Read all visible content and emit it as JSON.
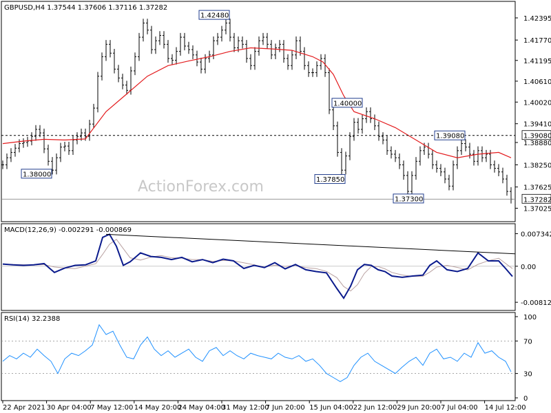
{
  "main_header": "GBPUSD,H4  1.37544 1.37606 1.37116 1.37282",
  "macd_header": "MACD(12,26,9) -0.002291 -0.000869",
  "rsi_header": "RSI(14) 32.2388",
  "watermark": "ActionForex.com",
  "colors": {
    "price": "#000000",
    "sma": "#e31a1c",
    "macd": "#0a1a8c",
    "signal": "#b8a0a0",
    "rsi": "#1e90ff",
    "label_border": "#1f3b8c"
  },
  "chart_data": [
    {
      "type": "line",
      "panel": "price",
      "ylim": [
        1.36725,
        1.4255
      ],
      "y_ticks": [
        "1.42395",
        "1.41770",
        "1.41195",
        "1.40610",
        "1.40020",
        "1.39410",
        "1.38880",
        "1.38250",
        "1.37625",
        "1.37025"
      ],
      "y_tick_values": [
        1.42395,
        1.4177,
        1.41195,
        1.4061,
        1.4002,
        1.3941,
        1.3888,
        1.3825,
        1.37625,
        1.37025
      ],
      "series": [
        {
          "style": "bar",
          "x": [
            0,
            6,
            12,
            18,
            24,
            30,
            36,
            42,
            48,
            54,
            60,
            66,
            72,
            78,
            84,
            90,
            96,
            102,
            108,
            114,
            120,
            126,
            132,
            138,
            144,
            150,
            156,
            162,
            168,
            174,
            180,
            186,
            192,
            198,
            204,
            210,
            216,
            222,
            228,
            234,
            240,
            246,
            252,
            258,
            264,
            270,
            276,
            282,
            288,
            294,
            300,
            306,
            312,
            318,
            324,
            330,
            336,
            342,
            348,
            354,
            360,
            366,
            372,
            378,
            384,
            390,
            396,
            402,
            408,
            414,
            420,
            426,
            432,
            438,
            444,
            450,
            456,
            462,
            468,
            474,
            480,
            486,
            492,
            498,
            504,
            510,
            516,
            522,
            528,
            534,
            540,
            546,
            552,
            558,
            564,
            570,
            576,
            582,
            588,
            594,
            600,
            606,
            612,
            618,
            624,
            630,
            636,
            642,
            648,
            654,
            660,
            666,
            672,
            678,
            684,
            690,
            696,
            702,
            708,
            714,
            720,
            726,
            732,
            738
          ],
          "values": [
            1.3825,
            1.3845,
            1.386,
            1.3872,
            1.3885,
            1.3888,
            1.3892,
            1.3905,
            1.3925,
            1.3915,
            1.387,
            1.3835,
            1.381,
            1.3845,
            1.3875,
            1.3878,
            1.3865,
            1.3895,
            1.3905,
            1.3915,
            1.3905,
            1.394,
            1.3985,
            1.4075,
            1.413,
            1.4165,
            1.414,
            1.4095,
            1.407,
            1.405,
            1.4035,
            1.409,
            1.413,
            1.4185,
            1.4225,
            1.4205,
            1.415,
            1.4175,
            1.419,
            1.4165,
            1.4125,
            1.412,
            1.4145,
            1.4185,
            1.416,
            1.415,
            1.4135,
            1.4115,
            1.4095,
            1.4125,
            1.4135,
            1.4175,
            1.4185,
            1.4205,
            1.4225,
            1.4185,
            1.4155,
            1.4175,
            1.4165,
            1.4125,
            1.4105,
            1.4145,
            1.4175,
            1.4185,
            1.4165,
            1.4135,
            1.4155,
            1.4165,
            1.4125,
            1.4105,
            1.4135,
            1.4175,
            1.4145,
            1.4105,
            1.4085,
            1.4085,
            1.4105,
            1.4125,
            1.4085,
            1.398,
            1.3935,
            1.386,
            1.381,
            1.385,
            1.3905,
            1.3945,
            1.3925,
            1.3955,
            1.3975,
            1.3955,
            1.3935,
            1.3905,
            1.3895,
            1.3865,
            1.3855,
            1.3845,
            1.3825,
            1.3795,
            1.375,
            1.3795,
            1.3835,
            1.3865,
            1.3875,
            1.3855,
            1.3825,
            1.3815,
            1.3805,
            1.3785,
            1.3765,
            1.3825,
            1.3865,
            1.3885,
            1.3875,
            1.3855,
            1.3835,
            1.3865,
            1.3845,
            1.3855,
            1.3825,
            1.3815,
            1.3805,
            1.3785,
            1.375,
            1.3728
          ]
        },
        {
          "name": "SMA",
          "x": [
            0,
            30,
            60,
            90,
            120,
            150,
            180,
            210,
            240,
            270,
            300,
            330,
            360,
            390,
            420,
            450,
            465,
            480,
            495,
            510,
            540,
            570,
            600,
            630,
            660,
            690,
            720,
            738
          ],
          "values": [
            1.3885,
            1.3892,
            1.3897,
            1.3895,
            1.3898,
            1.3975,
            1.4025,
            1.4075,
            1.4105,
            1.4118,
            1.413,
            1.4145,
            1.4155,
            1.4152,
            1.4148,
            1.413,
            1.4115,
            1.408,
            1.402,
            1.3975,
            1.3955,
            1.393,
            1.3895,
            1.386,
            1.3845,
            1.3855,
            1.386,
            1.3845
          ]
        }
      ],
      "annotations": [
        "1.42480",
        "1.38000",
        "1.40000",
        "1.37850",
        "1.39080",
        "1.37300"
      ],
      "annotation_values": [
        1.4248,
        1.38,
        1.4,
        1.3785,
        1.3908,
        1.373
      ],
      "annotation_x": [
        331,
        73,
        524,
        499,
        673,
        613
      ],
      "horizontal_level": "1.39080",
      "last_price": "1.37282"
    },
    {
      "type": "line",
      "panel": "macd",
      "ylim": [
        -0.0095,
        0.0085
      ],
      "y_ticks": [
        "0.007342",
        "0.00",
        "-0.008126"
      ],
      "y_tick_values": [
        0.007342,
        0.0,
        -0.008126
      ],
      "series": [
        {
          "name": "MACD",
          "x": [
            0,
            15,
            30,
            45,
            60,
            75,
            90,
            105,
            120,
            135,
            145,
            155,
            165,
            175,
            185,
            200,
            215,
            230,
            245,
            260,
            275,
            290,
            305,
            320,
            335,
            350,
            365,
            380,
            395,
            410,
            425,
            440,
            455,
            470,
            485,
            495,
            505,
            515,
            525,
            535,
            545,
            555,
            565,
            580,
            595,
            610,
            620,
            630,
            645,
            660,
            675,
            690,
            705,
            720,
            730,
            740
          ],
          "values": [
            0.0005,
            0.0003,
            0.0002,
            0.0003,
            0.0006,
            -0.0014,
            -0.0004,
            0.0002,
            0.0003,
            0.0012,
            0.0065,
            0.0072,
            0.0045,
            0.0002,
            0.001,
            0.003,
            0.0022,
            0.002,
            0.0015,
            0.002,
            0.001,
            0.0015,
            0.0008,
            0.0016,
            0.0012,
            -0.0005,
            0.0002,
            -0.0003,
            0.0008,
            -0.0006,
            0.0004,
            -0.0008,
            -0.0012,
            -0.0015,
            -0.005,
            -0.0072,
            -0.0045,
            -0.0008,
            0.0004,
            0.0002,
            -0.0008,
            -0.0012,
            -0.0022,
            -0.0025,
            -0.0022,
            -0.002,
            0.0002,
            0.0012,
            -0.0008,
            -0.0012,
            -0.0005,
            0.003,
            0.0012,
            0.0012,
            -0.0005,
            -0.0023
          ]
        }
      ],
      "trendline": "from the MACD peak near 7 May 12:00 down to the right edge"
    },
    {
      "type": "line",
      "panel": "rsi",
      "ylim": [
        0,
        100
      ],
      "y_ticks": [
        "100",
        "70",
        "30",
        "0"
      ],
      "y_tick_values": [
        100,
        70,
        30,
        0
      ],
      "series": [
        {
          "name": "RSI",
          "x": [
            0,
            10,
            20,
            30,
            40,
            50,
            60,
            70,
            80,
            90,
            100,
            110,
            120,
            130,
            140,
            150,
            160,
            170,
            180,
            190,
            200,
            210,
            220,
            230,
            240,
            250,
            260,
            270,
            280,
            290,
            300,
            310,
            320,
            330,
            340,
            350,
            360,
            370,
            380,
            390,
            400,
            410,
            420,
            430,
            440,
            450,
            460,
            470,
            480,
            490,
            500,
            510,
            520,
            530,
            540,
            550,
            560,
            570,
            580,
            590,
            600,
            610,
            620,
            630,
            640,
            650,
            660,
            670,
            680,
            690,
            700,
            710,
            720,
            730,
            738
          ],
          "values": [
            45,
            52,
            48,
            55,
            50,
            60,
            52,
            45,
            30,
            48,
            55,
            52,
            58,
            65,
            90,
            78,
            82,
            65,
            50,
            48,
            65,
            75,
            60,
            52,
            58,
            50,
            55,
            60,
            50,
            45,
            58,
            62,
            52,
            58,
            52,
            48,
            55,
            52,
            50,
            48,
            55,
            50,
            48,
            52,
            45,
            48,
            40,
            30,
            25,
            20,
            25,
            40,
            50,
            55,
            45,
            40,
            35,
            30,
            38,
            45,
            50,
            40,
            55,
            60,
            48,
            50,
            45,
            55,
            50,
            68,
            55,
            58,
            50,
            45,
            32
          ]
        }
      ]
    }
  ],
  "x_axis_labels": [
    "22 Apr 2021",
    "30 Apr 04:00",
    "7 May 12:00",
    "14 May 20:00",
    "24 May 04:00",
    "31 May 12:00",
    "7 Jun 20:00",
    "15 Jun 04:00",
    "22 Jun 12:00",
    "29 Jun 20:00",
    "7 Jul 04:00",
    "14 Jul 12:00"
  ]
}
